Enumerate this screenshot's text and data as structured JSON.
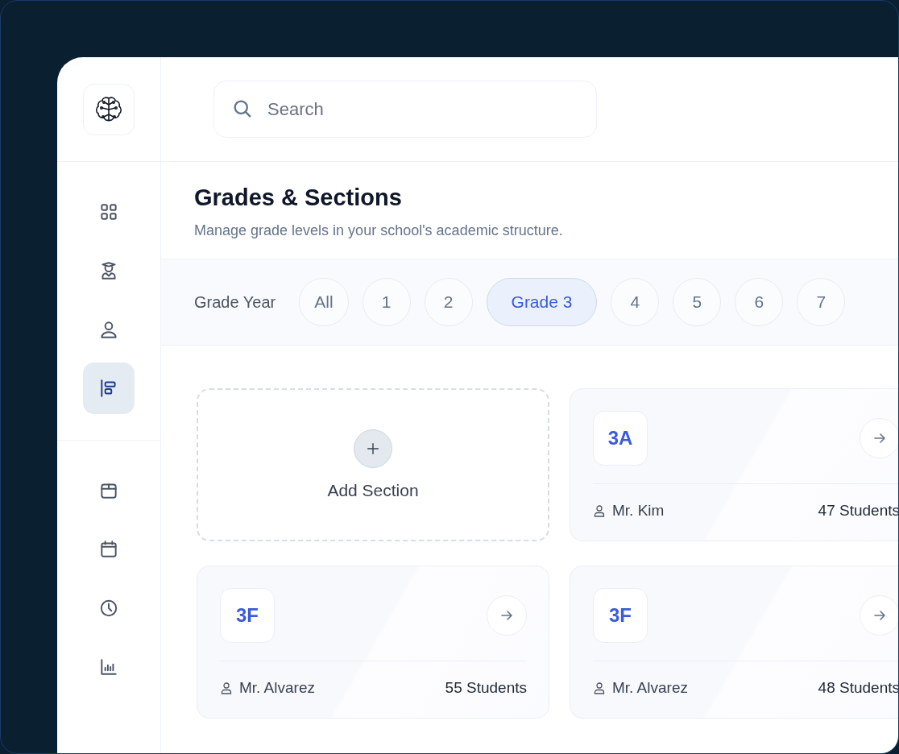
{
  "sidebar": {
    "nav_groups": [
      [
        {
          "selected": false
        },
        {
          "selected": false
        },
        {
          "selected": false
        },
        {
          "selected": true
        }
      ],
      [
        {
          "selected": false
        },
        {
          "selected": false
        },
        {
          "selected": false
        },
        {
          "selected": false
        }
      ]
    ]
  },
  "search": {
    "placeholder": "Search"
  },
  "header": {
    "title": "Grades & Sections",
    "subtitle": "Manage grade levels in your school's academic structure."
  },
  "filter": {
    "label": "Grade Year",
    "chips": [
      {
        "label": "All",
        "selected": false
      },
      {
        "label": "1",
        "selected": false
      },
      {
        "label": "2",
        "selected": false
      },
      {
        "label": "Grade 3",
        "selected": true
      },
      {
        "label": "4",
        "selected": false
      },
      {
        "label": "5",
        "selected": false
      },
      {
        "label": "6",
        "selected": false
      },
      {
        "label": "7",
        "selected": false
      }
    ]
  },
  "add_card": {
    "label": "Add Section"
  },
  "cards": [
    {
      "kind": "section",
      "code": "3A",
      "teacher": "Mr. Kim",
      "students": "47 Students"
    },
    {
      "kind": "section",
      "code": "3F",
      "teacher": "Mr. Alvarez",
      "students": "55 Students"
    },
    {
      "kind": "section",
      "code": "3F",
      "teacher": "Mr. Alvarez",
      "students": "48 Students"
    }
  ]
}
